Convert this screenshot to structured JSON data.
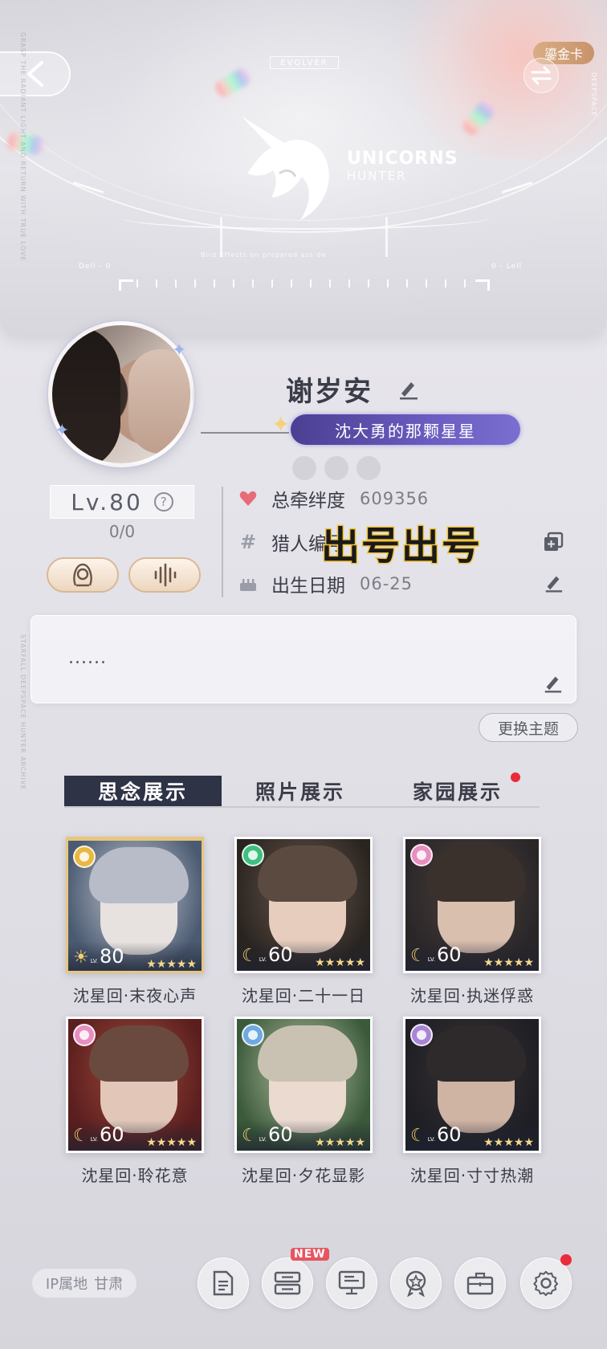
{
  "header": {
    "evolver_label": "EVOLVER",
    "logo_line1": "UNICORNS",
    "logo_line2": "HUNTER",
    "gold_tag": "鎏金卡",
    "deepspace": "DEEPSPACE",
    "hud_left": "Dell - 0",
    "hud_right": "0 - Lell",
    "hud_mid": "Bird Effects on prepared ass de"
  },
  "profile": {
    "name": "谢岁安",
    "title_badge": "沈大勇的那颗星星",
    "level": "Lv.80",
    "help": "?",
    "level_sub": "0/0",
    "stats": [
      {
        "label": "总牵绊度",
        "value": "609356"
      },
      {
        "label": "猎人编号",
        "value": ""
      },
      {
        "label": "出生日期",
        "value": "06-25"
      }
    ],
    "overlay_text": "出号出号",
    "bio": "......",
    "theme_button": "更换主题"
  },
  "tabs": [
    {
      "label": "思念展示",
      "active": true
    },
    {
      "label": "照片展示",
      "active": false
    },
    {
      "label": "家园展示",
      "active": false,
      "badge": true
    }
  ],
  "cards": [
    {
      "label": "沈星回·末夜心声",
      "level": "80",
      "gem_color": "#e9b840",
      "gold": true,
      "symbol": "☀"
    },
    {
      "label": "沈星回·二十一日",
      "level": "60",
      "gem_color": "#3fbf7f",
      "gold": false,
      "symbol": "☾"
    },
    {
      "label": "沈星回·执迷俘惑",
      "level": "60",
      "gem_color": "#e78fc0",
      "gold": false,
      "symbol": "☾"
    },
    {
      "label": "沈星回·聆花意",
      "level": "60",
      "gem_color": "#e78fc0",
      "gold": false,
      "symbol": "☾"
    },
    {
      "label": "沈星回·夕花显影",
      "level": "60",
      "gem_color": "#6fa9e0",
      "gold": false,
      "symbol": "☾"
    },
    {
      "label": "沈星回·寸寸热潮",
      "level": "60",
      "gem_color": "#a985d6",
      "gold": false,
      "symbol": "☾"
    }
  ],
  "card_lv_prefix": "LV.",
  "card_stars": "★★★★★",
  "footer": {
    "ip_label": "IP属地",
    "ip_value": "甘肃",
    "new_tag": "NEW"
  },
  "colors": {
    "accent_dark": "#2e3346",
    "badge_purple": "#5b4fae",
    "heart": "#e86b78",
    "gold": "#d8ad86",
    "notification": "#ea2b3b"
  }
}
